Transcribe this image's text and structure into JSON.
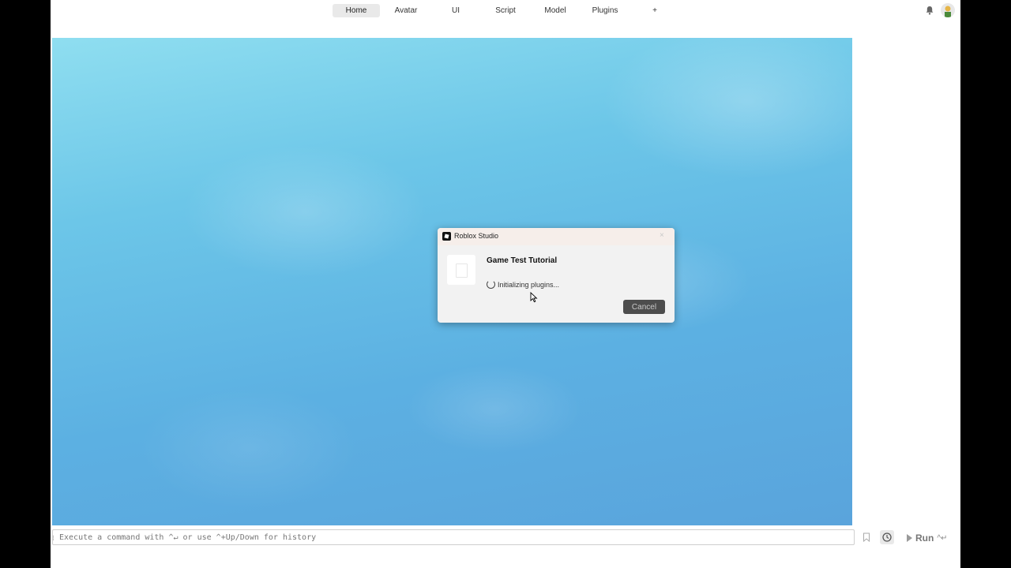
{
  "ribbon": {
    "tabs": [
      {
        "label": "Home",
        "active": true
      },
      {
        "label": "Avatar",
        "active": false
      },
      {
        "label": "UI",
        "active": false
      },
      {
        "label": "Script",
        "active": false
      },
      {
        "label": "Model",
        "active": false
      },
      {
        "label": "Plugins",
        "active": false
      },
      {
        "label": "+",
        "active": false
      }
    ],
    "icons": [
      "bell-icon",
      "avatar"
    ]
  },
  "dialog": {
    "window_title": "Roblox Studio",
    "close_glyph": "×",
    "game_title": "Game Test Tutorial",
    "status": "Initializing plugins...",
    "cancel_label": "Cancel"
  },
  "command_bar": {
    "placeholder": "Execute a command with ^↵ or use ^+Up/Down for history",
    "run_label": "Run",
    "run_shortcut": "^↵"
  },
  "colors": {
    "sky_top": "#8fdef0",
    "sky_bottom": "#5aa4dc",
    "cancel_bg": "#4d4d4d"
  }
}
